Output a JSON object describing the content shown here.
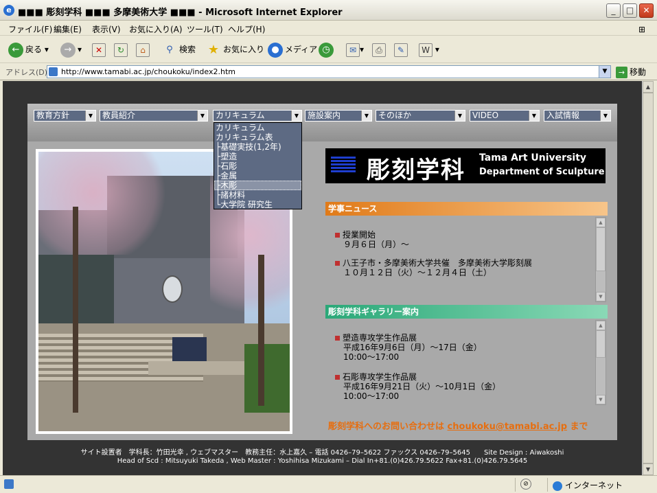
{
  "window": {
    "title": "■■■ 彫刻学科 ■■■ 多摩美術大学 ■■■ - Microsoft Internet Explorer",
    "min": "_",
    "max": "□",
    "close": "✕"
  },
  "menu": [
    "ファイル(F)",
    "編集(E)",
    "表示(V)",
    "お気に入り(A)",
    "ツール(T)",
    "ヘルプ(H)"
  ],
  "toolbar": {
    "back": "戻る",
    "search": "検索",
    "favorites": "お気に入り",
    "media": "メディア"
  },
  "address": {
    "label": "アドレス(D)",
    "url": "http://www.tamabi.ac.jp/choukoku/index2.htm",
    "go": "移動"
  },
  "nav": [
    {
      "label": "教育方針"
    },
    {
      "label": "教員紹介"
    },
    {
      "label": "カリキュラム"
    },
    {
      "label": "施設案内"
    },
    {
      "label": "そのほか"
    },
    {
      "label": "VIDEO"
    },
    {
      "label": "入試情報"
    }
  ],
  "dropdown": {
    "items": [
      "カリキュラム",
      "カリキュラム表",
      "├基礎実技(1,2年)",
      "├塑造",
      "├石彫",
      "├金属",
      "├木彫",
      "├諸材料",
      "└大学院 研究生"
    ],
    "highlighted": 6
  },
  "logo": {
    "jp": "彫刻学科",
    "en1": "Tama Art University",
    "en2": "Department of Sculpture"
  },
  "news": {
    "title": "学事ニュース",
    "items": [
      {
        "line1": "授業開始",
        "line2": "９月６日（月）～"
      },
      {
        "line1": "八王子市・多摩美術大学共催　多摩美術大学彫刻展",
        "line2": "１０月１２日（火）～１２月４日（土）"
      }
    ]
  },
  "gallery": {
    "title": "彫刻学科ギャラリー案内",
    "items": [
      {
        "line1": "塑造専攻学生作品展",
        "line2": "平成16年9月6日（月）～17日（金）",
        "line3": "10:00～17:00"
      },
      {
        "line1": "石彫専攻学生作品展",
        "line2": "平成16年9月21日（火）～10月1日（金）",
        "line3": "10:00～17:00"
      }
    ]
  },
  "contact": {
    "pre": "彫刻学科へのお問い合わせは",
    "email": "choukoku@tamabi.ac.jp",
    "post": "まで"
  },
  "footer": {
    "line1": "サイト設置者　学科長：竹田光幸 , ウェブマスター　教務主任：水上嘉久 – 電話 0426–79–5622 ファックス 0426–79–5645　　Site Design : Aiwakoshi",
    "line2": "Head of Scd : Mitsuyuki Takeda , Web Master : Yoshihisa Mizukami – Dial In+81.(0)426.79.5622 Fax+81.(0)426.79.5645"
  },
  "status": {
    "zone": "インターネット"
  }
}
